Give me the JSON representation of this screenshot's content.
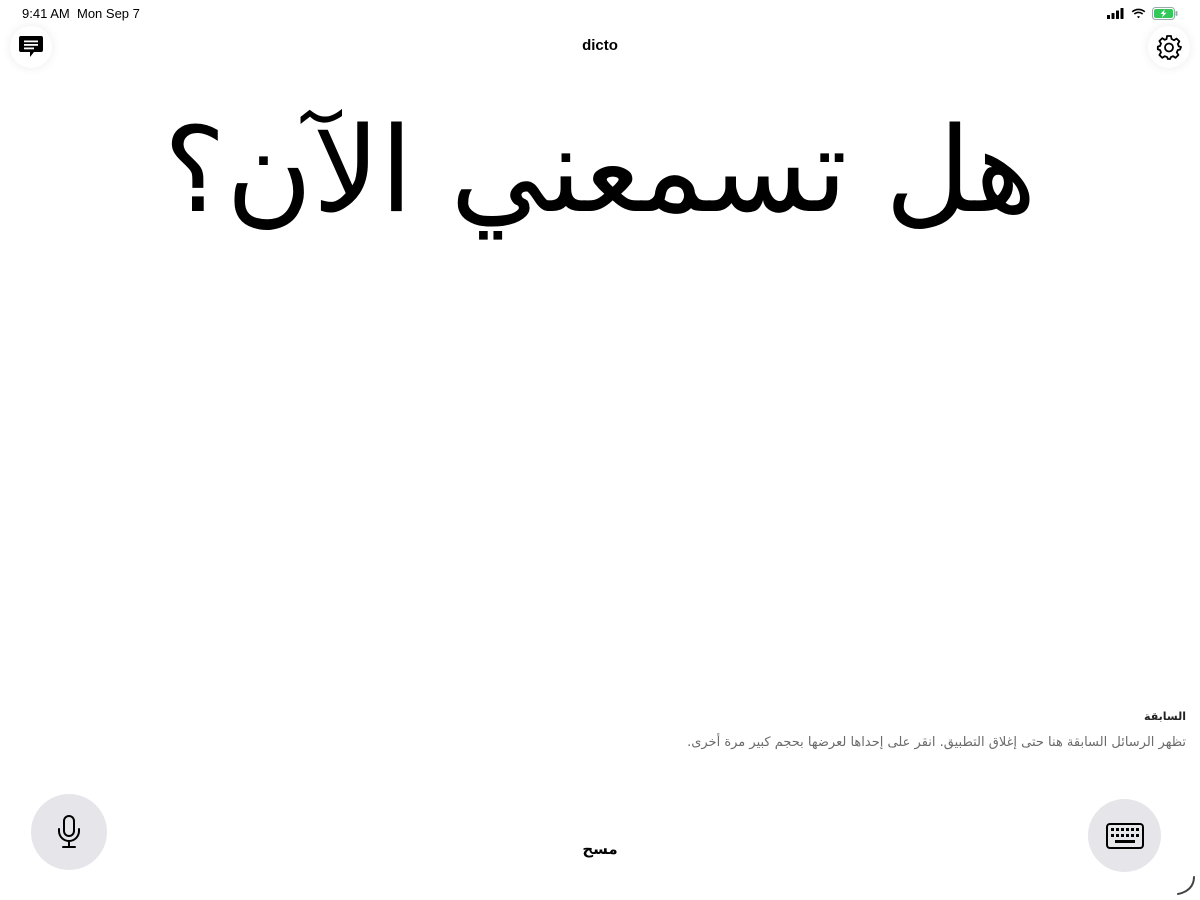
{
  "status_bar": {
    "time": "9:41 AM",
    "date": "Mon Sep 7"
  },
  "header": {
    "title": "dicto",
    "left_icon": "message-icon",
    "right_icon": "gear-icon"
  },
  "main": {
    "text": "هل تسمعني الآن؟"
  },
  "previous": {
    "heading": "السابقة",
    "description": "تظهر الرسائل السابقة هنا حتى إغلاق التطبيق. انقر على إحداها لعرضها بحجم كبير مرة أخرى."
  },
  "footer": {
    "clear_label": "مسح",
    "mic_icon": "microphone-icon",
    "keyboard_icon": "keyboard-icon"
  },
  "colors": {
    "background": "#ffffff",
    "button_fill": "#e5e5ea",
    "battery": "#34c759",
    "secondary_text": "#6b6b6b"
  }
}
